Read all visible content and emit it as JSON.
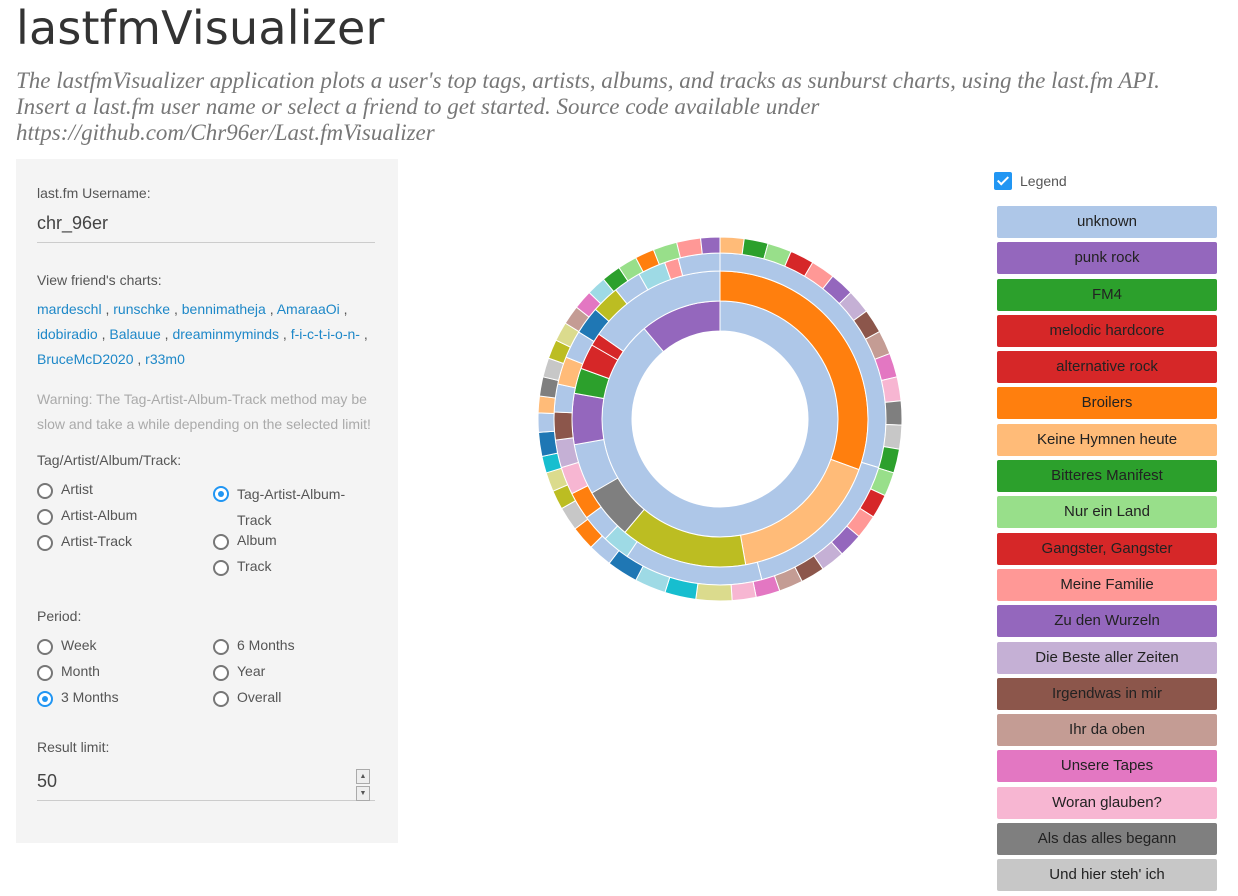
{
  "header": {
    "title": "lastfmVisualizer",
    "description": "The lastfmVisualizer application plots a user's top tags, artists, albums, and tracks as sunburst charts, using the last.fm API. Insert a last.fm user name or select a friend to get started. Source code available under https://github.com/Chr96er/Last.fmVisualizer"
  },
  "sidebar": {
    "username_label": "last.fm Username:",
    "username_value": "chr_96er",
    "friends_label": "View friend's charts:",
    "friends": [
      "mardeschl",
      "runschke",
      "bennimatheja",
      "AmaraaOi",
      "idobiradio",
      "Balauue",
      "dreaminmyminds",
      "f-i-c-t-i-o-n-",
      "BruceMcD2020",
      "r33m0"
    ],
    "warning": "Warning: The Tag-Artist-Album-Track method may be slow and take a while depending on the selected limit!",
    "method_label": "Tag/Artist/Album/Track:",
    "method_options": [
      {
        "label": "Artist",
        "selected": false
      },
      {
        "label": "Artist-Album",
        "selected": false
      },
      {
        "label": "Artist-Track",
        "selected": false
      },
      {
        "label": "Tag-Artist-Album-Track",
        "selected": true
      },
      {
        "label": "Album",
        "selected": false
      },
      {
        "label": "Track",
        "selected": false
      }
    ],
    "period_label": "Period:",
    "period_options": [
      {
        "label": "Week",
        "selected": false
      },
      {
        "label": "Month",
        "selected": false
      },
      {
        "label": "3 Months",
        "selected": true
      },
      {
        "label": "6 Months",
        "selected": false
      },
      {
        "label": "Year",
        "selected": false
      },
      {
        "label": "Overall",
        "selected": false
      }
    ],
    "limit_label": "Result limit:",
    "limit_value": "50"
  },
  "legend": {
    "toggle_label": "Legend",
    "checked": true,
    "items": [
      {
        "label": "unknown",
        "color": "#aec7e8"
      },
      {
        "label": "punk rock",
        "color": "#9467bd"
      },
      {
        "label": "FM4",
        "color": "#2ca02c"
      },
      {
        "label": "melodic hardcore",
        "color": "#d62728"
      },
      {
        "label": "alternative rock",
        "color": "#d62728"
      },
      {
        "label": "Broilers",
        "color": "#ff7f0e"
      },
      {
        "label": "Keine Hymnen heute",
        "color": "#ffbb78"
      },
      {
        "label": "Bitteres Manifest",
        "color": "#2ca02c"
      },
      {
        "label": "Nur ein Land",
        "color": "#98df8a"
      },
      {
        "label": "Gangster, Gangster",
        "color": "#d62728"
      },
      {
        "label": "Meine Familie",
        "color": "#ff9896"
      },
      {
        "label": "Zu den Wurzeln",
        "color": "#9467bd"
      },
      {
        "label": "Die Beste aller Zeiten",
        "color": "#c5b0d5"
      },
      {
        "label": "Irgendwas in mir",
        "color": "#8c564b"
      },
      {
        "label": "Ihr da oben",
        "color": "#c49c94"
      },
      {
        "label": "Unsere Tapes",
        "color": "#e377c2"
      },
      {
        "label": "Woran glauben?",
        "color": "#f7b6d2"
      },
      {
        "label": "Als das alles begann",
        "color": "#7f7f7f"
      },
      {
        "label": "Und hier steh' ich",
        "color": "#c7c7c7"
      }
    ]
  },
  "chart_data": {
    "type": "sunburst",
    "rings": [
      [
        {
          "value": 32,
          "color": "#aec7e8"
        },
        {
          "value": 4,
          "color": "#9467bd"
        }
      ],
      [
        {
          "value": 11,
          "color": "#ff7f0e"
        },
        {
          "value": 6,
          "color": "#ffbb78"
        },
        {
          "value": 5,
          "color": "#bcbd22"
        },
        {
          "value": 2,
          "color": "#7f7f7f"
        },
        {
          "value": 2,
          "color": "#aec7e8"
        },
        {
          "value": 2,
          "color": "#9467bd"
        },
        {
          "value": 1,
          "color": "#2ca02c"
        },
        {
          "value": 1,
          "color": "#d62728"
        },
        {
          "value": 0.5,
          "color": "#d62728"
        },
        {
          "value": 5.5,
          "color": "#aec7e8"
        }
      ],
      [
        {
          "value": 11,
          "color": "#aec7e8"
        },
        {
          "value": 6,
          "color": "#aec7e8"
        },
        {
          "value": 5,
          "color": "#aec7e8"
        },
        {
          "value": 1,
          "color": "#9edae5"
        },
        {
          "value": 1,
          "color": "#aec7e8"
        },
        {
          "value": 1,
          "color": "#ff7f0e"
        },
        {
          "value": 1,
          "color": "#f7b6d2"
        },
        {
          "value": 1,
          "color": "#c5b0d5"
        },
        {
          "value": 1,
          "color": "#8c564b"
        },
        {
          "value": 1,
          "color": "#aec7e8"
        },
        {
          "value": 1,
          "color": "#ffbb78"
        },
        {
          "value": 1,
          "color": "#aec7e8"
        },
        {
          "value": 1,
          "color": "#1f77b4"
        },
        {
          "value": 1,
          "color": "#bcbd22"
        },
        {
          "value": 1,
          "color": "#aec7e8"
        },
        {
          "value": 1,
          "color": "#9edae5"
        },
        {
          "value": 0.5,
          "color": "#ff9896"
        },
        {
          "value": 1.5,
          "color": "#aec7e8"
        }
      ],
      [
        {
          "value": 1,
          "color": "#ffbb78"
        },
        {
          "value": 1,
          "color": "#2ca02c"
        },
        {
          "value": 1,
          "color": "#98df8a"
        },
        {
          "value": 1,
          "color": "#d62728"
        },
        {
          "value": 1,
          "color": "#ff9896"
        },
        {
          "value": 1,
          "color": "#9467bd"
        },
        {
          "value": 1,
          "color": "#c5b0d5"
        },
        {
          "value": 1,
          "color": "#8c564b"
        },
        {
          "value": 1,
          "color": "#c49c94"
        },
        {
          "value": 1,
          "color": "#e377c2"
        },
        {
          "value": 1,
          "color": "#f7b6d2"
        },
        {
          "value": 1,
          "color": "#7f7f7f"
        },
        {
          "value": 1,
          "color": "#c7c7c7"
        },
        {
          "value": 1,
          "color": "#2ca02c"
        },
        {
          "value": 1,
          "color": "#98df8a"
        },
        {
          "value": 1,
          "color": "#d62728"
        },
        {
          "value": 1,
          "color": "#ff9896"
        },
        {
          "value": 1,
          "color": "#9467bd"
        },
        {
          "value": 1,
          "color": "#c5b0d5"
        },
        {
          "value": 1,
          "color": "#8c564b"
        },
        {
          "value": 1,
          "color": "#c49c94"
        },
        {
          "value": 1,
          "color": "#e377c2"
        },
        {
          "value": 1,
          "color": "#f7b6d2"
        },
        {
          "value": 1.5,
          "color": "#dbdb8d"
        },
        {
          "value": 1.3,
          "color": "#17becf"
        },
        {
          "value": 1.3,
          "color": "#9edae5"
        },
        {
          "value": 1.3,
          "color": "#1f77b4"
        },
        {
          "value": 1,
          "color": "#aec7e8"
        },
        {
          "value": 1,
          "color": "#ff7f0e"
        },
        {
          "value": 1,
          "color": "#c7c7c7"
        },
        {
          "value": 0.8,
          "color": "#bcbd22"
        },
        {
          "value": 0.8,
          "color": "#dbdb8d"
        },
        {
          "value": 0.7,
          "color": "#17becf"
        },
        {
          "value": 1,
          "color": "#1f77b4"
        },
        {
          "value": 0.8,
          "color": "#aec7e8"
        },
        {
          "value": 0.7,
          "color": "#ffbb78"
        },
        {
          "value": 0.8,
          "color": "#7f7f7f"
        },
        {
          "value": 0.8,
          "color": "#c7c7c7"
        },
        {
          "value": 0.8,
          "color": "#bcbd22"
        },
        {
          "value": 0.8,
          "color": "#dbdb8d"
        },
        {
          "value": 0.8,
          "color": "#c49c94"
        },
        {
          "value": 0.8,
          "color": "#e377c2"
        },
        {
          "value": 0.8,
          "color": "#9edae5"
        },
        {
          "value": 0.8,
          "color": "#2ca02c"
        },
        {
          "value": 0.8,
          "color": "#98df8a"
        },
        {
          "value": 0.8,
          "color": "#ff7f0e"
        },
        {
          "value": 1,
          "color": "#98df8a"
        },
        {
          "value": 1,
          "color": "#ff9896"
        },
        {
          "value": 0.8,
          "color": "#9467bd"
        }
      ]
    ]
  }
}
